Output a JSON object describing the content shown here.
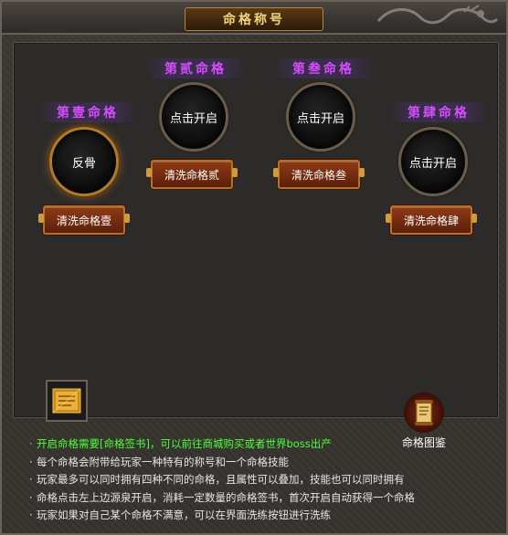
{
  "window": {
    "title": "命格称号"
  },
  "slots": [
    {
      "label": "第壹命格",
      "state": "反骨",
      "button": "清洗命格壹"
    },
    {
      "label": "第贰命格",
      "state": "点击开启",
      "button": "清洗命格贰"
    },
    {
      "label": "第叁命格",
      "state": "点击开启",
      "button": "清洗命格叁"
    },
    {
      "label": "第肆命格",
      "state": "点击开启",
      "button": "清洗命格肆"
    }
  ],
  "guide": {
    "label": "命格图鉴",
    "icon": "scroll-icon"
  },
  "item": {
    "icon": "signing-book-icon"
  },
  "tips": [
    "开启命格需要[命格签书]，可以前往商城购买或者世界boss出产",
    "每个命格会附带给玩家一种特有的称号和一个命格技能",
    "玩家最多可以同时拥有四种不同的命格，且属性可以叠加，技能也可以同时拥有",
    "命格点击左上边源泉开启，消耗一定数量的命格签书，首次开启自动获得一个命格",
    "玩家如果对自己某个命格不满意，可以在界面洗练按钮进行洗练"
  ],
  "colors": {
    "label_purple": "#d64cff",
    "tip_green": "#4cff3a",
    "title_gold": "#f0d37a"
  }
}
